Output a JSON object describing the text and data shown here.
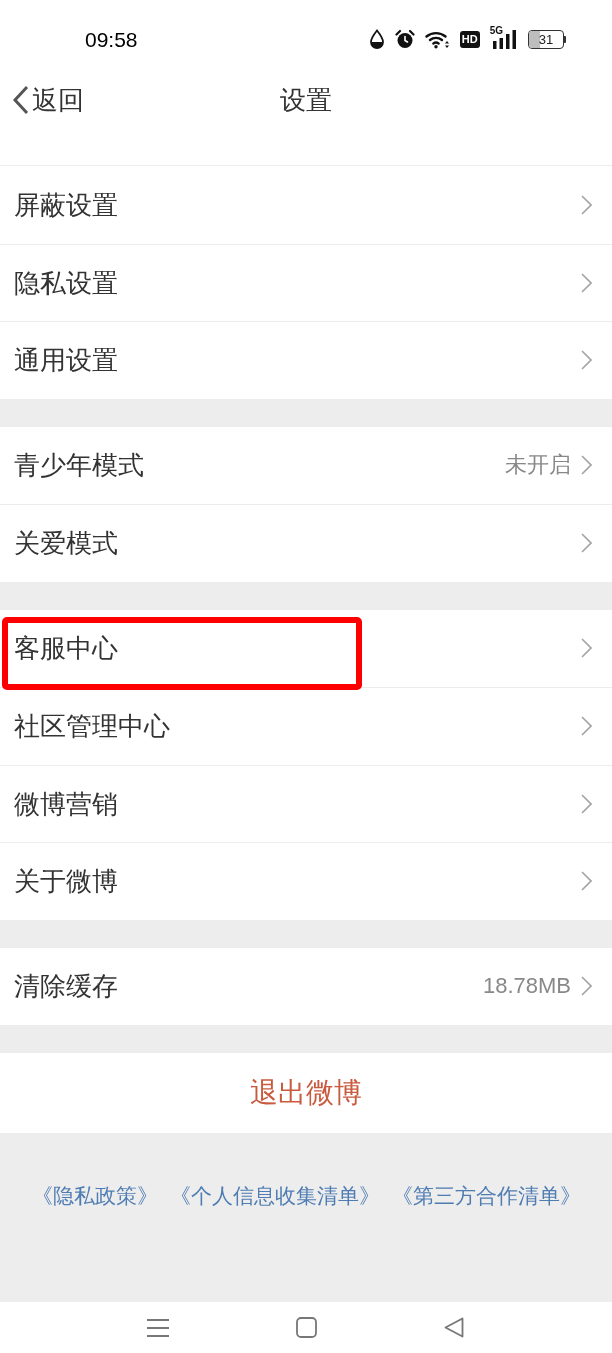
{
  "status_bar": {
    "time": "09:58",
    "hd": "HD",
    "network": "5G",
    "battery": "31"
  },
  "header": {
    "back": "返回",
    "title": "设置"
  },
  "groups": [
    {
      "rows": [
        {
          "label": "屏蔽设置",
          "highlighted": false
        },
        {
          "label": "隐私设置",
          "highlighted": false
        },
        {
          "label": "通用设置",
          "highlighted": false
        }
      ]
    },
    {
      "rows": [
        {
          "label": "青少年模式",
          "value": "未开启",
          "highlighted": false
        },
        {
          "label": "关爱模式",
          "highlighted": false
        }
      ]
    },
    {
      "rows": [
        {
          "label": "客服中心",
          "highlighted": true
        },
        {
          "label": "社区管理中心",
          "highlighted": false
        },
        {
          "label": "微博营销",
          "highlighted": false
        },
        {
          "label": "关于微博",
          "highlighted": false
        }
      ]
    },
    {
      "rows": [
        {
          "label": "清除缓存",
          "value": "18.78MB",
          "highlighted": false
        }
      ]
    }
  ],
  "logout_button": "退出微博",
  "footer_links": [
    "《隐私政策》",
    "《个人信息收集清单》",
    "《第三方合作清单》"
  ]
}
